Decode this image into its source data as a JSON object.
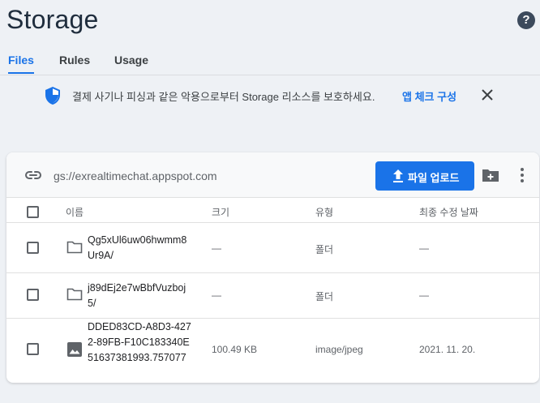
{
  "page": {
    "title": "Storage"
  },
  "tabs": [
    {
      "label": "Files",
      "active": true
    },
    {
      "label": "Rules",
      "active": false
    },
    {
      "label": "Usage",
      "active": false
    }
  ],
  "banner": {
    "text": "결제 사기나 피싱과 같은 악용으로부터 Storage 리소스를 보호하세요.",
    "link": "앱 체크 구성"
  },
  "toolbar": {
    "bucket_path": "gs://exrealtimechat.appspot.com",
    "upload_label": "파일 업로드"
  },
  "table": {
    "headers": {
      "name": "이름",
      "size": "크기",
      "type": "유형",
      "modified": "최종 수정 날짜"
    },
    "rows": [
      {
        "name": "Qg5xUl6uw06hwmm8Ur9A/",
        "size": "—",
        "type": "폴더",
        "modified": "—",
        "kind": "folder"
      },
      {
        "name": "j89dEj2e7wBbfVuzboj5/",
        "size": "—",
        "type": "폴더",
        "modified": "—",
        "kind": "folder"
      },
      {
        "name": "DDED83CD-A8D3-4272-89FB-F10C183340E51637381993.757077",
        "size": "100.49 KB",
        "type": "image/jpeg",
        "modified": "2021. 11. 20.",
        "kind": "image"
      }
    ]
  },
  "colors": {
    "accent": "#1a73e8",
    "background": "#eef1f5"
  }
}
